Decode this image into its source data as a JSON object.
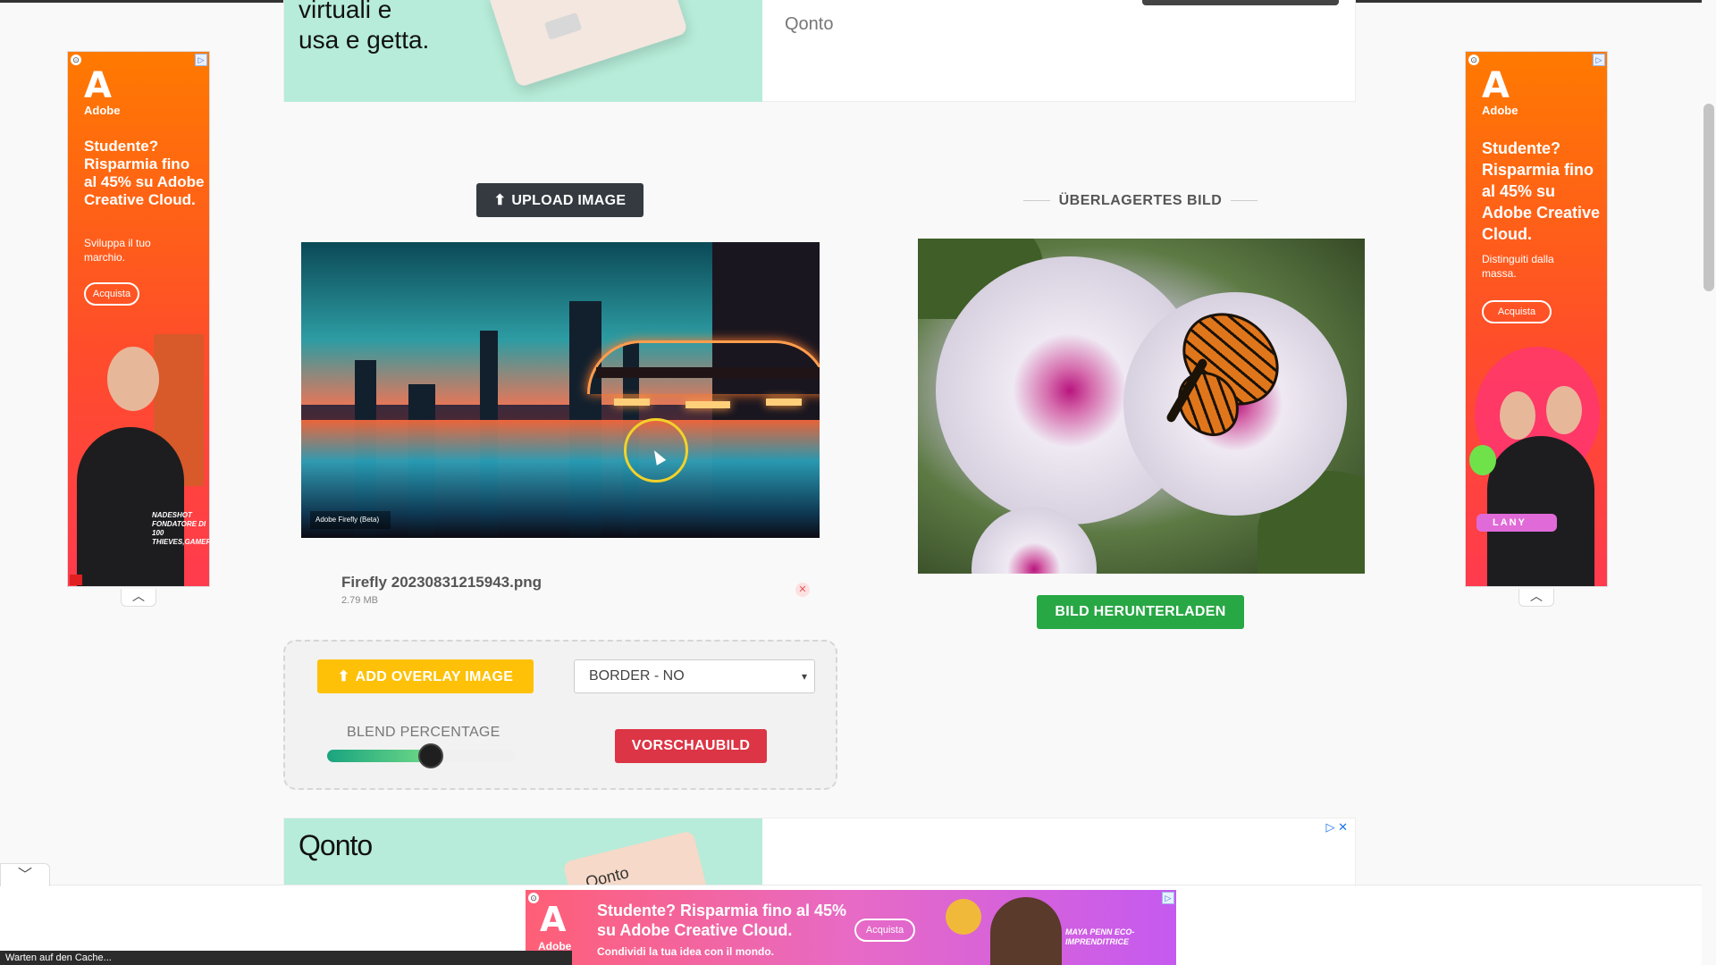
{
  "top_ad": {
    "left_text_line1": "virtuali e",
    "left_text_line2": "usa e getta.",
    "brand": "Qonto"
  },
  "left_side_ad": {
    "logo_word": "Adobe",
    "headline": "Studente? Risparmia fino al 45% su Adobe Creative Cloud.",
    "sub": "Sviluppa il tuo marchio.",
    "cta": "Acquista",
    "caption": "NADESHOT FONDATORE DI 100 THIEVES,GAMER"
  },
  "right_side_ad": {
    "logo_word": "Adobe",
    "headline": "Studente? Risparmia fino al 45% su Adobe Creative Cloud.",
    "sub": "Distinguiti dalla massa.",
    "cta": "Acquista",
    "caption": "LANY"
  },
  "upload": {
    "label": "UPLOAD IMAGE",
    "icon": "upload-icon"
  },
  "source_image": {
    "watermark": "Adobe Firefly (Beta)"
  },
  "file": {
    "name": "Firefly 20230831215943.png",
    "size": "2.79 MB",
    "remove_icon": "close-icon"
  },
  "result": {
    "title": "ÜBERLAGERTES BILD",
    "download_label": "BILD HERUNTERLADEN"
  },
  "controls": {
    "add_overlay_label": "ADD OVERLAY IMAGE",
    "border_select_value": "BORDER - NO",
    "blend_label": "BLEND PERCENTAGE",
    "blend_value_fraction": 0.55,
    "preview_label": "VORSCHAUBILD"
  },
  "bottom_ad": {
    "brand": "Qonto",
    "card_text": "Qonto"
  },
  "footer_ad": {
    "logo_word": "Adobe",
    "headline": "Studente? Risparmia fino al 45% su Adobe Creative Cloud.",
    "sub": "Condividi la tua idea con il mondo.",
    "cta": "Acquista",
    "caption": "MAYA PENN ECO-IMPRENDITRICE"
  },
  "status_bar": {
    "text": "Warten auf den Cache..."
  },
  "colors": {
    "upload_button": "#343a40",
    "download_button": "#28a745",
    "overlay_button": "#ffc107",
    "preview_button": "#dc3545"
  }
}
